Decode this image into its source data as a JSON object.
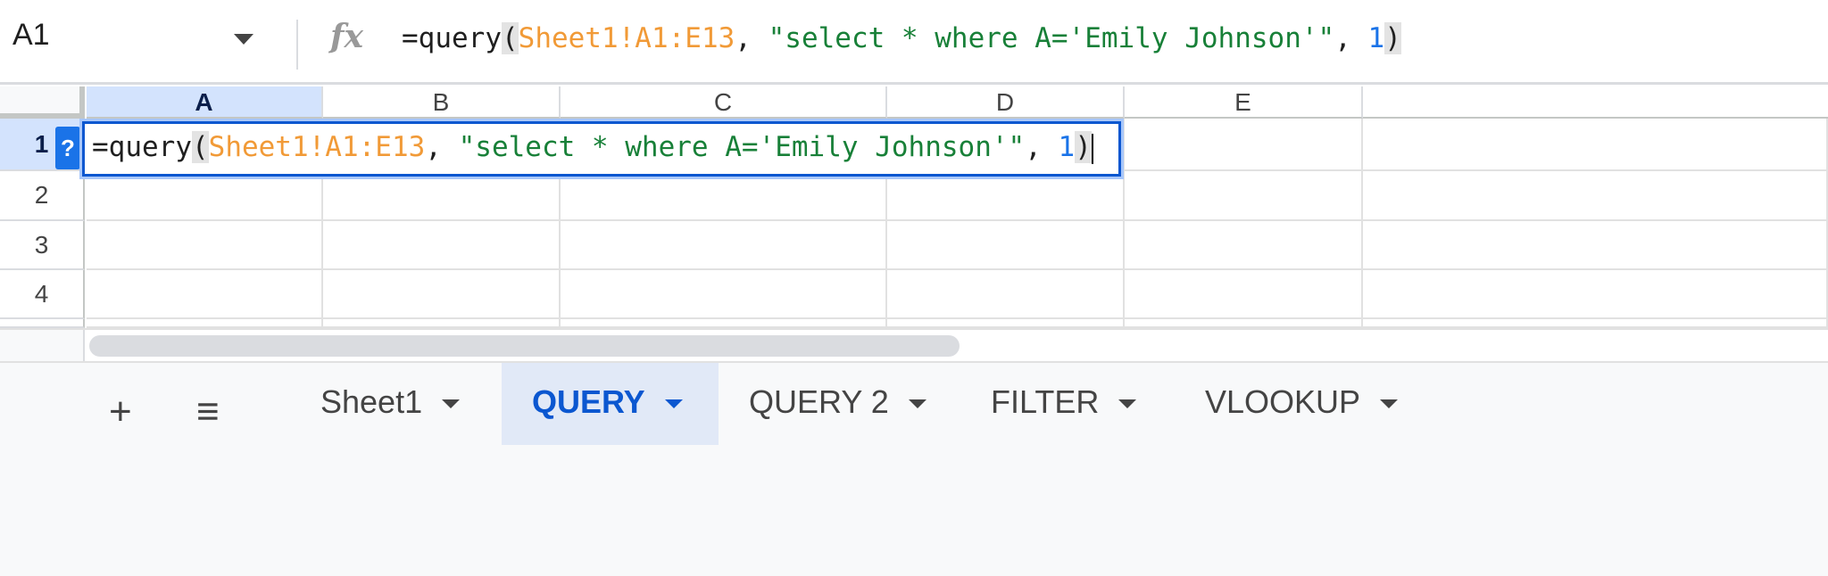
{
  "formula_bar": {
    "name_box": "A1",
    "fx_icon": "fx-icon",
    "formula_fn": "=query",
    "formula_ref": "Sheet1!A1:E13",
    "formula_sep1": ", ",
    "formula_str": "\"select * where A='Emily Johnson'\"",
    "formula_sep2": ", ",
    "formula_num": "1"
  },
  "columns": [
    "A",
    "B",
    "C",
    "D",
    "E"
  ],
  "rows": [
    "1",
    "2",
    "3",
    "4"
  ],
  "help_badge": "?",
  "tabs_bar": {
    "add_icon": "+",
    "menu_icon": "≡",
    "tabs": [
      {
        "label": "Sheet1"
      },
      {
        "label": "QUERY",
        "active": true
      },
      {
        "label": "QUERY 2"
      },
      {
        "label": "FILTER"
      },
      {
        "label": "VLOOKUP"
      }
    ]
  }
}
